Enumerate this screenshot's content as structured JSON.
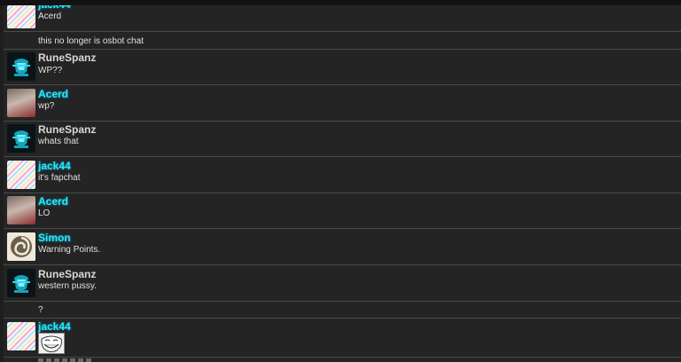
{
  "chat": {
    "messages": [
      {
        "user": "jack44",
        "text": "Acerd",
        "avatar": "striped-avatar"
      },
      {
        "text": "this no longer is osbot chat"
      },
      {
        "user": "RuneSpanz",
        "text": "WP??",
        "avatar": "teal-guild-avatar"
      },
      {
        "user": "Acerd",
        "text": "wp?",
        "avatar": "photo-avatar"
      },
      {
        "user": "RuneSpanz",
        "text": "whats that",
        "avatar": "teal-guild-avatar"
      },
      {
        "user": "jack44",
        "text": "it's fapchat",
        "avatar": "striped-avatar"
      },
      {
        "user": "Acerd",
        "text": "LO",
        "avatar": "photo-avatar"
      },
      {
        "user": "Simon",
        "text": "Warning Points.",
        "avatar": "swirl-avatar"
      },
      {
        "user": "RuneSpanz",
        "text": "western pussy.",
        "avatar": "teal-guild-avatar"
      },
      {
        "text": "?"
      },
      {
        "user": "jack44",
        "avatar": "striped-avatar",
        "emoticon": "trollface-emoticon"
      }
    ]
  },
  "colors": {
    "highlight_name": "#28e6ff",
    "regular_name": "#d8d8d8",
    "background": "#242424"
  }
}
